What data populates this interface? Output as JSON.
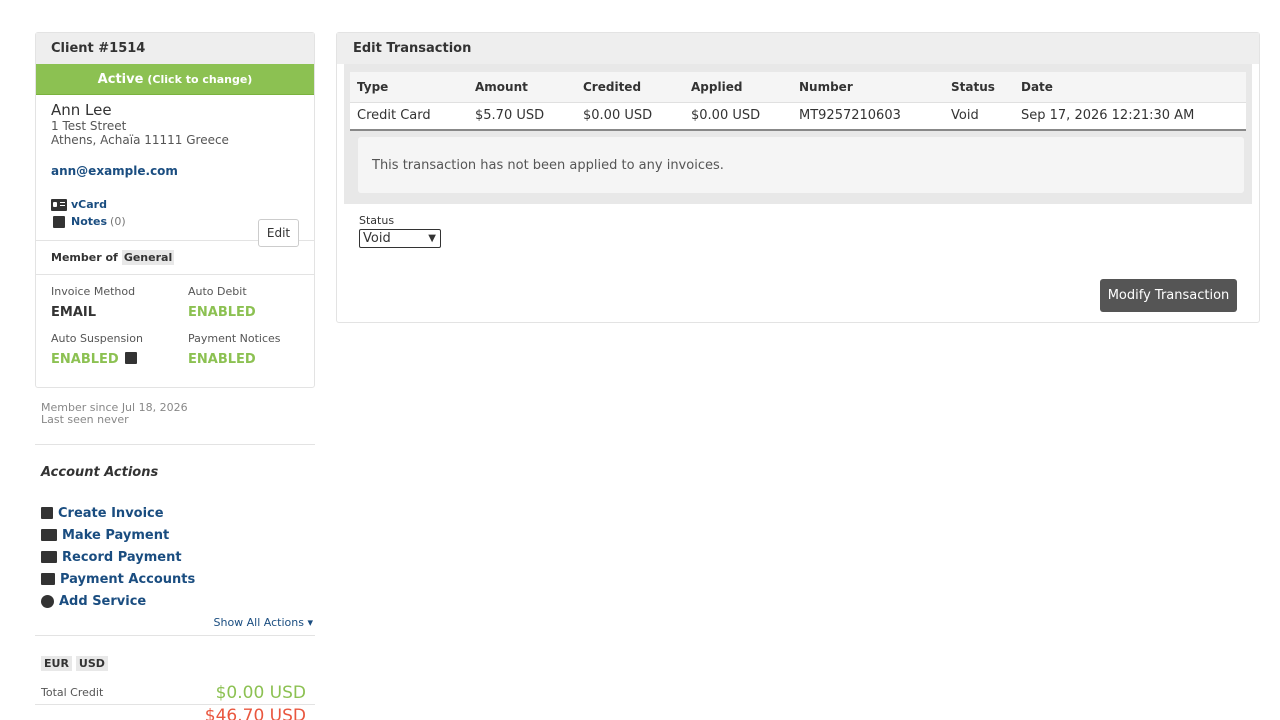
{
  "client": {
    "title": "Client #1514",
    "status_label": "Active",
    "status_hint": "(Click to change)",
    "name": "Ann Lee",
    "address_line1": "1 Test Street",
    "address_line2": "Athens, Achaïa 11111 Greece",
    "email": "ann@example.com",
    "vcard_label": "vCard",
    "notes_label": "Notes",
    "notes_count": "(0)",
    "edit_label": "Edit",
    "member_of_label": "Member of",
    "group": "General"
  },
  "settings": {
    "invoice_method_label": "Invoice Method",
    "invoice_method_value": "EMAIL",
    "auto_debit_label": "Auto Debit",
    "auto_debit_value": "ENABLED",
    "auto_suspension_label": "Auto Suspension",
    "auto_suspension_value": "ENABLED",
    "payment_notices_label": "Payment Notices",
    "payment_notices_value": "ENABLED"
  },
  "meta": {
    "member_since": "Member since Jul 18, 2026",
    "last_seen": "Last seen never"
  },
  "account_actions": {
    "title": "Account Actions",
    "items": [
      "Create Invoice",
      "Make Payment",
      "Record Payment",
      "Payment Accounts",
      "Add Service"
    ],
    "show_all": "Show All Actions ▾"
  },
  "balances": {
    "currencies": [
      "EUR",
      "USD"
    ],
    "total_credit_label": "Total Credit",
    "total_credit_value": "$0.00 USD",
    "due_value": "$46.70 USD"
  },
  "transaction": {
    "panel_title": "Edit Transaction",
    "columns": [
      "Type",
      "Amount",
      "Credited",
      "Applied",
      "Number",
      "Status",
      "Date"
    ],
    "row": [
      "Credit Card",
      "$5.70 USD",
      "$0.00 USD",
      "$0.00 USD",
      "MT9257210603",
      "Void",
      "Sep 17, 2026 12:21:30 AM"
    ],
    "note": "This transaction has not been applied to any invoices.",
    "status_label": "Status",
    "status_value": "Void",
    "modify_label": "Modify Transaction"
  },
  "colors": {
    "accent_green": "#8cc152",
    "link_blue": "#1a4d80",
    "due_red": "#e9573f"
  }
}
